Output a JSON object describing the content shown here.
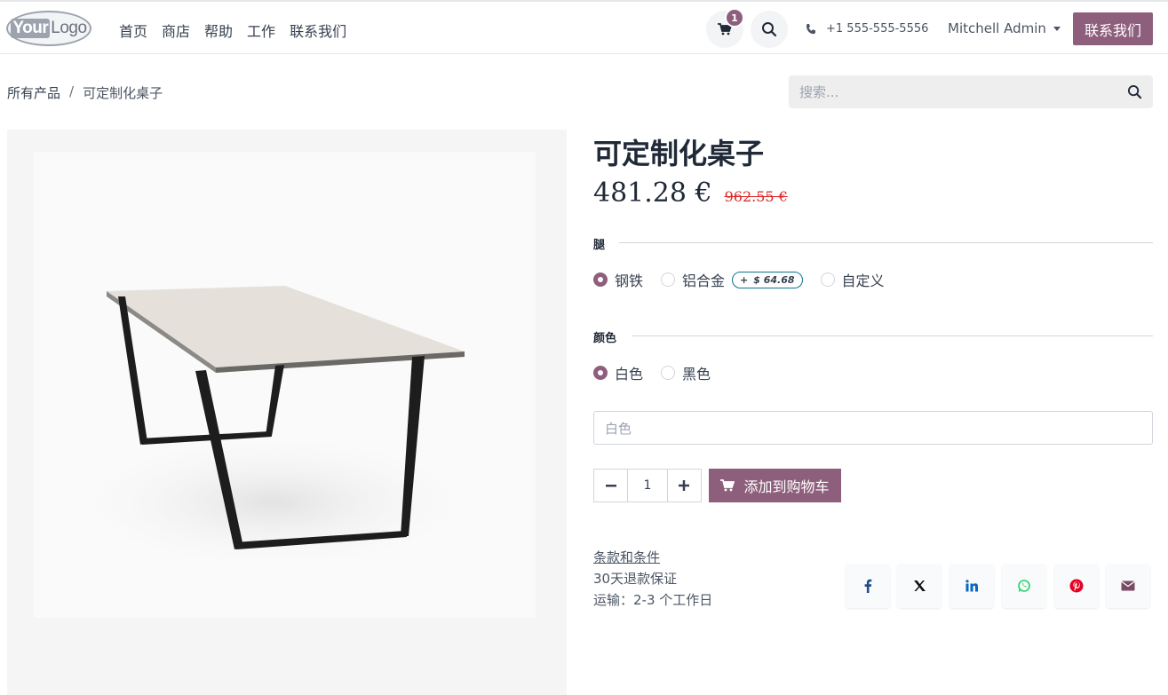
{
  "header": {
    "logo": {
      "bold": "Your",
      "text": "Logo"
    },
    "nav": [
      "首页",
      "商店",
      "帮助",
      "工作",
      "联系我们"
    ],
    "cart_count": "1",
    "phone": "+1 555-555-5556",
    "user": "Mitchell Admin",
    "contact_button": "联系我们"
  },
  "breadcrumb": {
    "parent": "所有产品",
    "separator": "/",
    "current": "可定制化桌子"
  },
  "search": {
    "placeholder": "搜索..."
  },
  "product": {
    "title": "可定制化桌子",
    "price": "481.28 €",
    "old_price": "962.55 €",
    "legs_label": "腿",
    "legs_options": [
      {
        "label": "钢铁",
        "checked": true
      },
      {
        "label": "铝合金",
        "checked": false,
        "extra": "$ 64.68",
        "extra_prefix": "+"
      },
      {
        "label": "自定义",
        "checked": false
      }
    ],
    "color_label": "颜色",
    "color_options": [
      {
        "label": "白色",
        "checked": true
      },
      {
        "label": "黑色",
        "checked": false
      }
    ],
    "custom_input_value": "白色",
    "quantity": "1",
    "add_to_cart": "添加到购物车",
    "terms_link": "条款和条件",
    "guarantee": "30天退款保证",
    "shipping": "运输：2-3 个工作日"
  },
  "colors": {
    "accent": "#8e5f7c",
    "old_price": "#dc2626"
  },
  "share_icons": [
    "facebook-icon",
    "x-icon",
    "linkedin-icon",
    "whatsapp-icon",
    "pinterest-icon",
    "email-icon"
  ]
}
